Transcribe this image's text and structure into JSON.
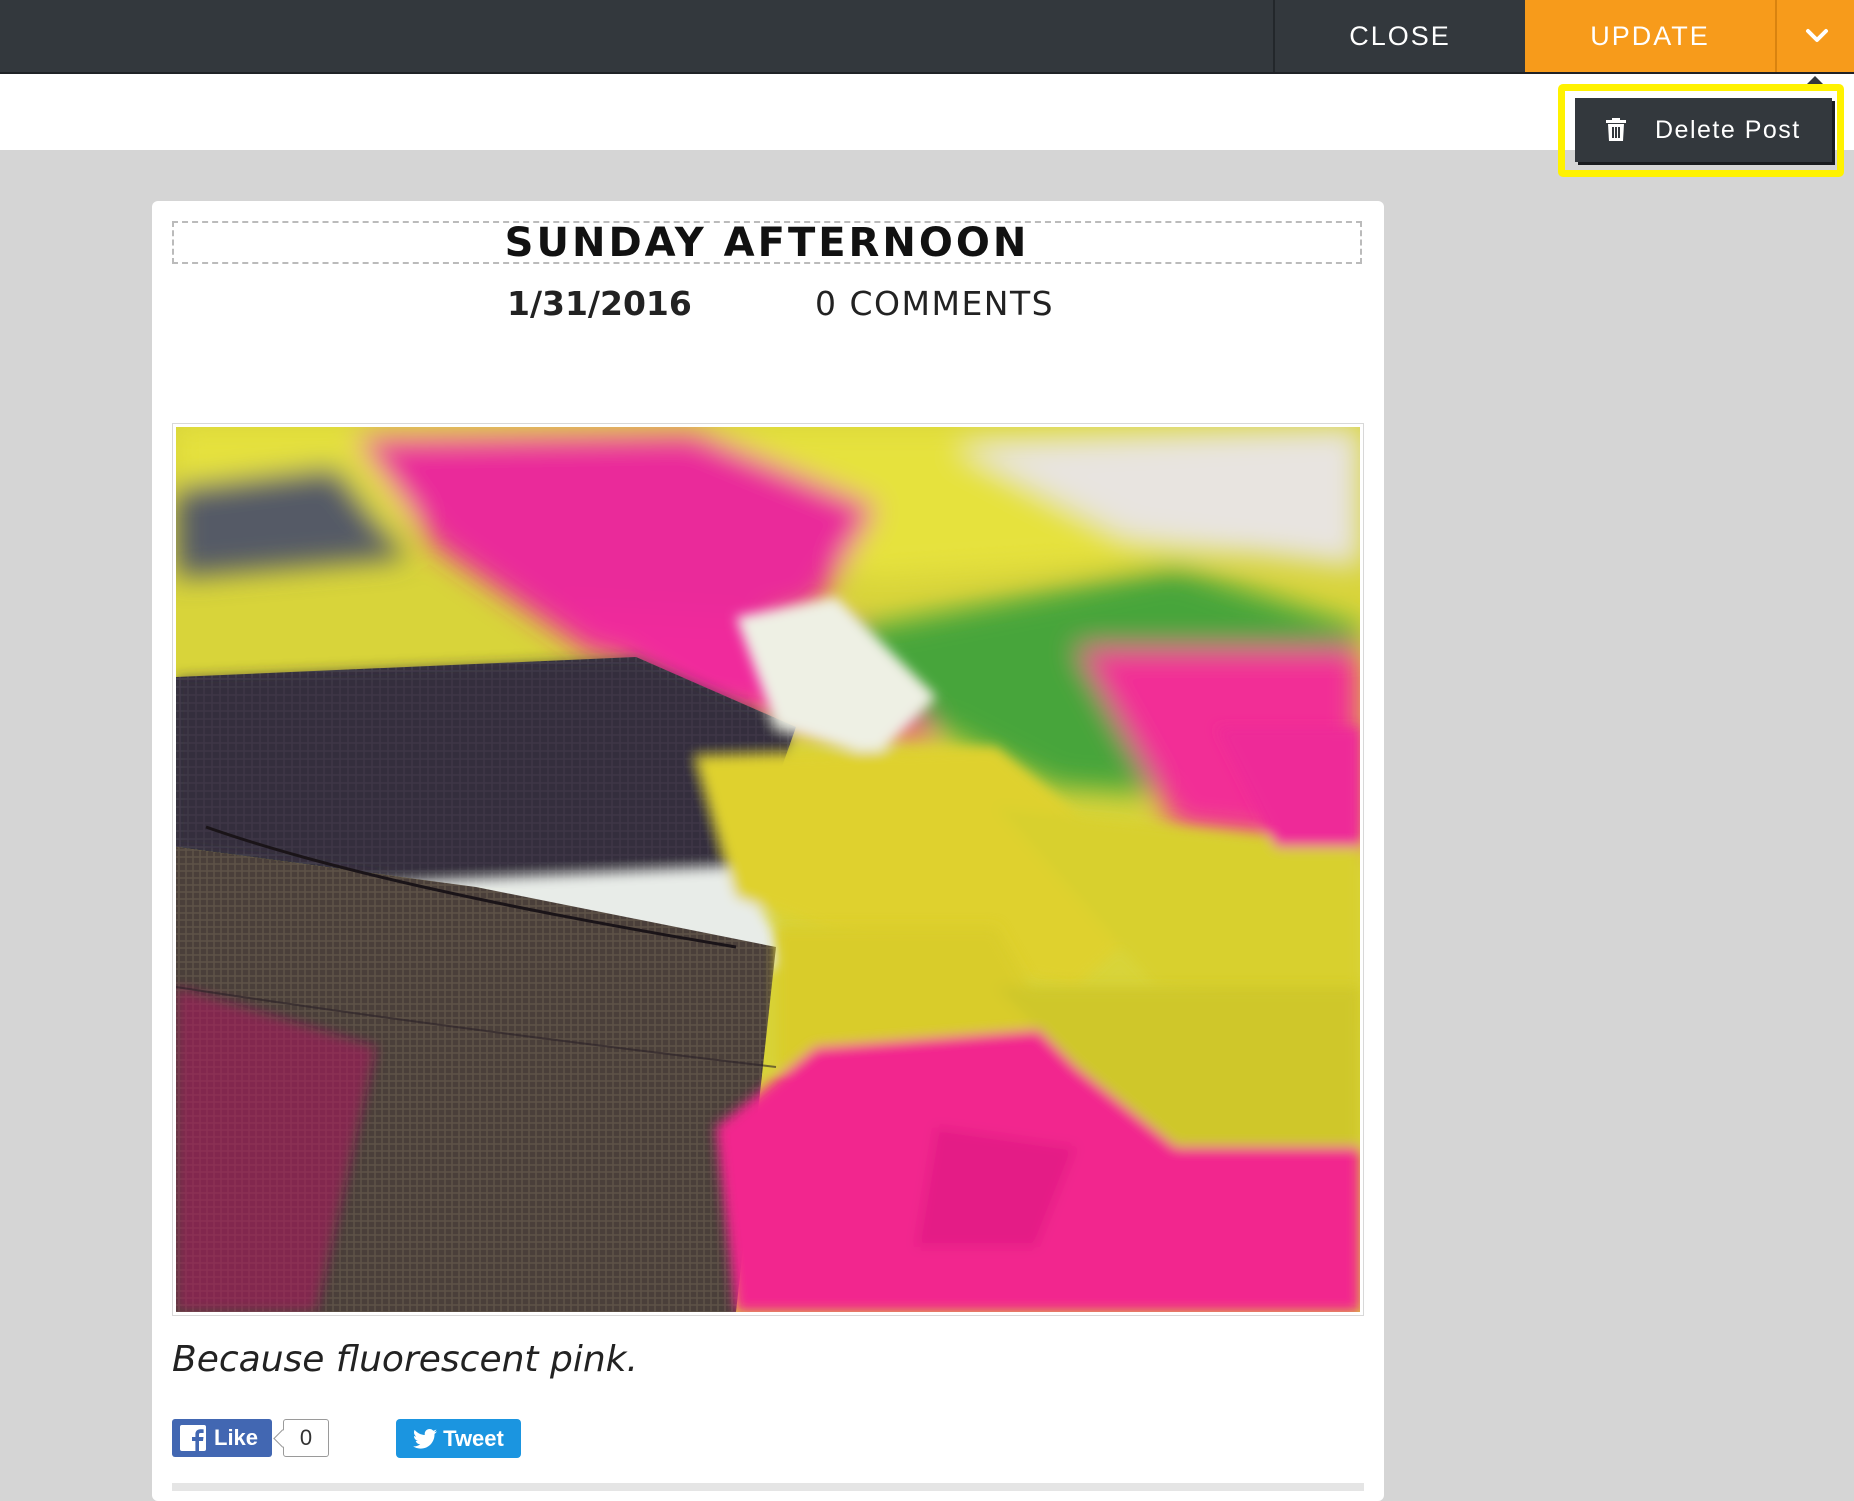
{
  "toolbar": {
    "close_label": "CLOSE",
    "update_label": "UPDATE",
    "dropdown_icon": "chevron-down-icon"
  },
  "dropdown_menu": {
    "delete_label": "Delete Post",
    "delete_icon": "trash-icon",
    "highlight_color": "#fff200"
  },
  "post": {
    "title": "SUNDAY AFTERNOON",
    "date": "1/31/2016",
    "comments": "0 COMMENTS",
    "caption": "Because fluorescent pink."
  },
  "social": {
    "like_label": "Like",
    "like_count": "0",
    "tweet_label": "Tweet"
  },
  "colors": {
    "toolbar_bg": "#33383d",
    "accent": "#f79b1b",
    "page_bg": "#d5d5d5"
  }
}
